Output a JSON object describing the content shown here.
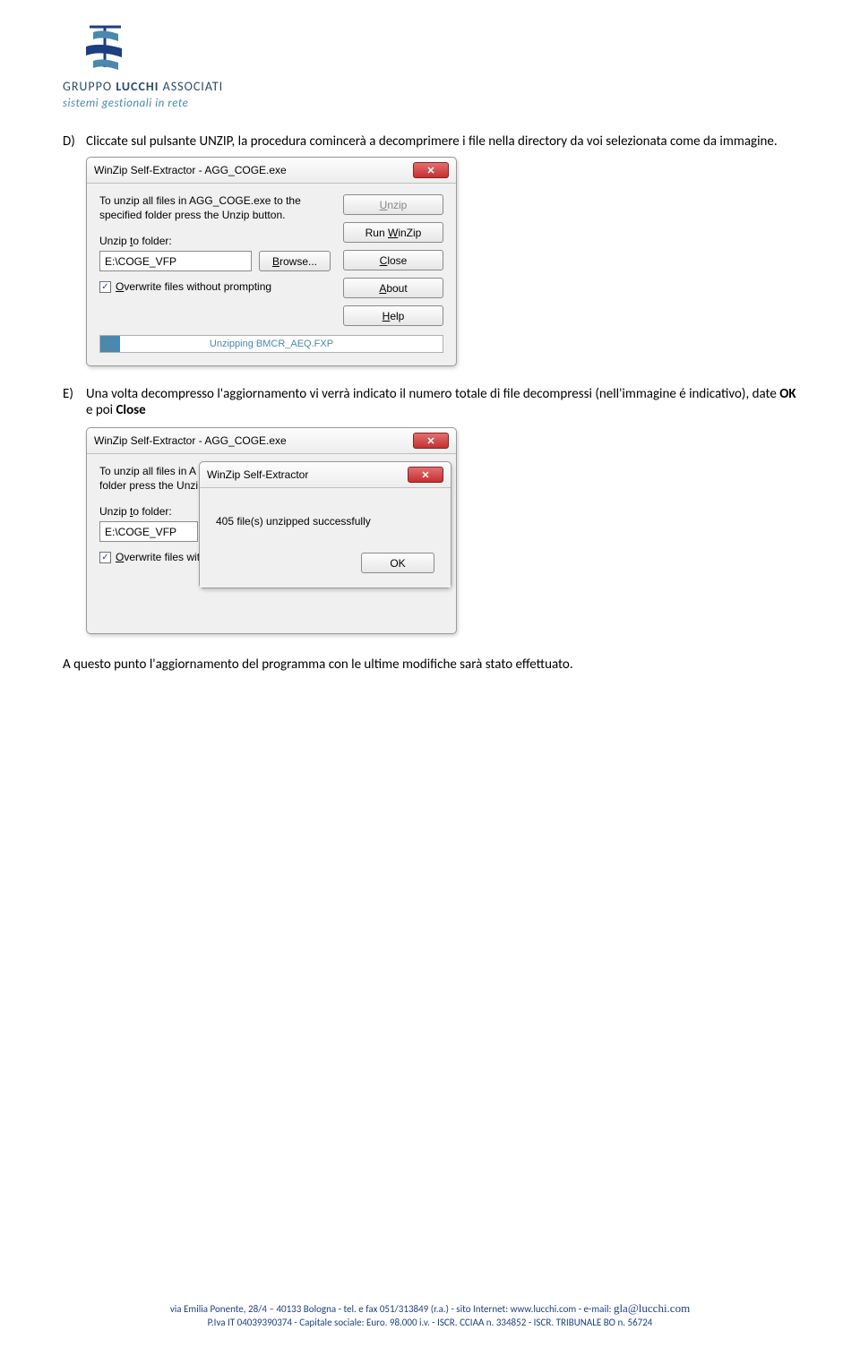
{
  "logo": {
    "line1_a": "GRUPPO",
    "line1_b": "LUCCHI",
    "line1_c": "ASSOCIATI",
    "line2": "sistemi gestionali in rete"
  },
  "item_d": {
    "letter": "D)",
    "text": "Cliccate sul pulsante UNZIP, la procedura comincerà a decomprimere i file nella directory da voi selezionata come da immagine."
  },
  "dlg1": {
    "title": "WinZip Self-Extractor - AGG_COGE.exe",
    "close_glyph": "✕",
    "desc": "To unzip all files in AGG_COGE.exe to the specified folder press the Unzip button.",
    "unzip_to_label_pre": "Unzip ",
    "unzip_to_label_u": "t",
    "unzip_to_label_post": "o folder:",
    "folder_value": "E:\\COGE_VFP",
    "browse_label_u": "B",
    "browse_label_post": "rowse...",
    "overwrite_pre": "",
    "overwrite_u": "O",
    "overwrite_post": "verwrite files without prompting",
    "check_glyph": "✓",
    "btn_unzip_u": "U",
    "btn_unzip_post": "nzip",
    "btn_runwz_pre": "Run ",
    "btn_runwz_u": "W",
    "btn_runwz_post": "inZip",
    "btn_close_u": "C",
    "btn_close_post": "lose",
    "btn_about_u": "A",
    "btn_about_post": "bout",
    "btn_help_u": "H",
    "btn_help_post": "elp",
    "progress_text": "Unzipping BMCR_AEQ.FXP"
  },
  "item_e": {
    "letter": "E)",
    "text_pre": "Una volta decompresso l'aggiornamento vi verrà indicato il numero totale di file decompressi (nell'immagine é indicativo), date ",
    "ok": "OK",
    "mid": " e poi ",
    "close": "Close"
  },
  "dlg2": {
    "title": "WinZip Self-Extractor - AGG_COGE.exe",
    "close_glyph": "✕",
    "desc_trunc1": "To unzip all files in A",
    "desc_trunc2": "folder press the Unzi",
    "unzip_to_label_pre": "Unzip ",
    "unzip_to_label_u": "t",
    "unzip_to_label_post": "o folder:",
    "folder_value": "E:\\COGE_VFP",
    "overwrite_trunc_u": "O",
    "overwrite_trunc_post": "verwrite files wit",
    "check_glyph": "✓"
  },
  "alert": {
    "title": "WinZip Self-Extractor",
    "close_glyph": "✕",
    "msg": "405 file(s) unzipped successfully",
    "ok": "OK"
  },
  "closing": "A questo punto l'aggiornamento del programma con le ultime modifiche sarà stato effettuato.",
  "footer": {
    "line1_pre": "via Emilia Ponente, 28/4 – 40133 Bologna - tel. e fax 051/313849 (r.a.) - sito Internet: www.lucchi.com - e-mail: ",
    "line1_mail": "gla@lucchi.com",
    "line2": "P.Iva IT 04039390374 - Capitale sociale: Euro. 98.000 i.v. - ISCR. CCIAA n. 334852 - ISCR. TRIBUNALE BO n. 56724"
  }
}
